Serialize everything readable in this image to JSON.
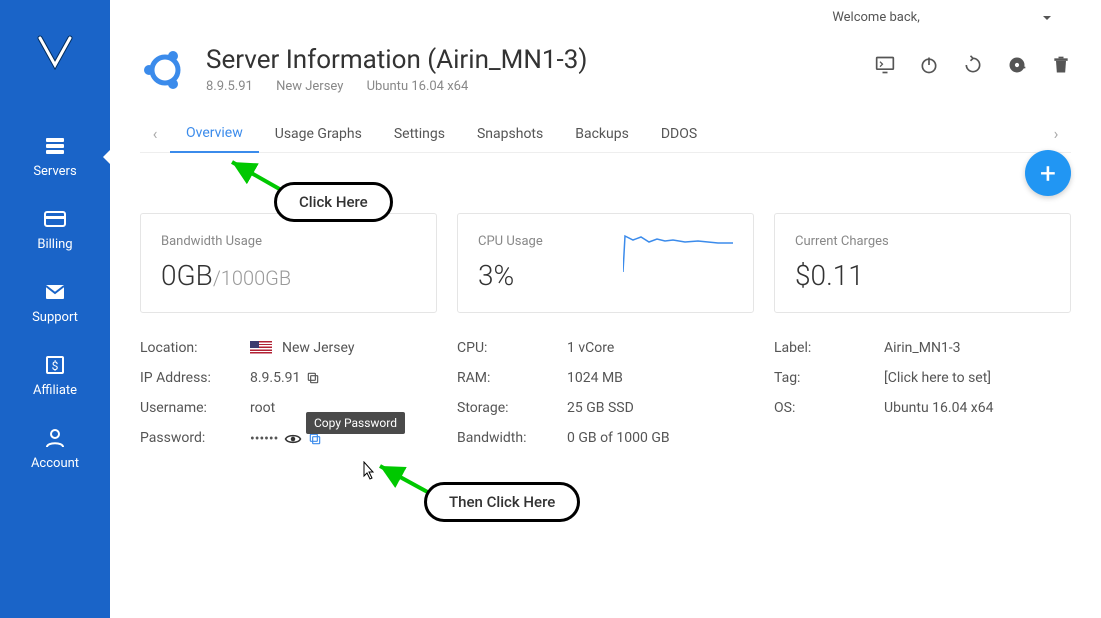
{
  "welcome": "Welcome back,",
  "sidebar": {
    "items": [
      {
        "label": "Servers"
      },
      {
        "label": "Billing"
      },
      {
        "label": "Support"
      },
      {
        "label": "Affiliate"
      },
      {
        "label": "Account"
      }
    ]
  },
  "header": {
    "title": "Server Information (Airin_MN1-3)",
    "ip": "8.9.5.91",
    "region": "New Jersey",
    "os": "Ubuntu 16.04 x64"
  },
  "tabs": [
    "Overview",
    "Usage Graphs",
    "Settings",
    "Snapshots",
    "Backups",
    "DDOS"
  ],
  "cards": {
    "bw": {
      "label": "Bandwidth Usage",
      "value": "0GB",
      "limit": "/1000GB"
    },
    "cpu": {
      "label": "CPU Usage",
      "value": "3%"
    },
    "charges": {
      "label": "Current Charges",
      "value": "$0.11"
    }
  },
  "details": {
    "col1": {
      "location": {
        "k": "Location:",
        "v": "New Jersey"
      },
      "ip": {
        "k": "IP Address:",
        "v": "8.9.5.91"
      },
      "user": {
        "k": "Username:",
        "v": "root"
      },
      "pass": {
        "k": "Password:",
        "v": "••••••"
      }
    },
    "col2": {
      "cpu": {
        "k": "CPU:",
        "v": "1 vCore"
      },
      "ram": {
        "k": "RAM:",
        "v": "1024 MB"
      },
      "storage": {
        "k": "Storage:",
        "v": "25 GB SSD"
      },
      "bw": {
        "k": "Bandwidth:",
        "v": "0 GB of 1000 GB"
      }
    },
    "col3": {
      "label": {
        "k": "Label:",
        "v": "Airin_MN1-3"
      },
      "tag": {
        "k": "Tag:",
        "v": "[Click here to set]"
      },
      "os": {
        "k": "OS:",
        "v": "Ubuntu 16.04 x64"
      }
    }
  },
  "tooltip": "Copy Password",
  "callout1": "Click Here",
  "callout2": "Then Click Here"
}
